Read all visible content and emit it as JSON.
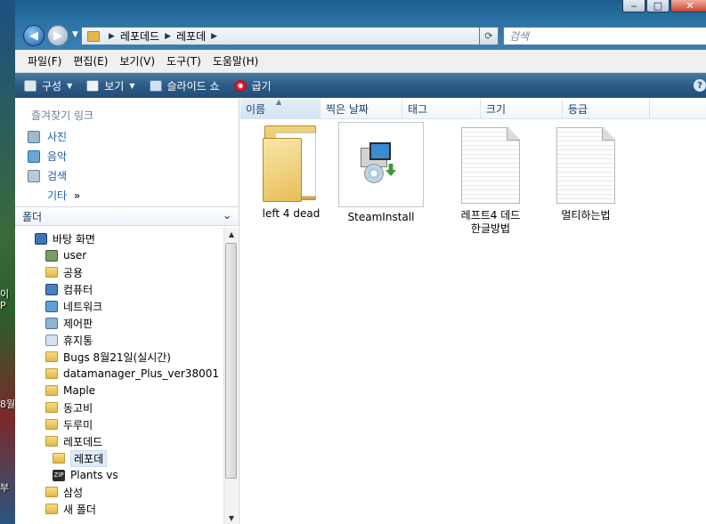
{
  "desktop": {
    "labels": [
      "이",
      "P",
      "8월",
      "부"
    ]
  },
  "window": {
    "caption": {
      "minimize": "‒",
      "maximize": "□",
      "close": "✕"
    },
    "address": {
      "path": [
        "레포데드",
        "레포데"
      ]
    },
    "search": {
      "placeholder": "검색"
    }
  },
  "menubar": {
    "items": [
      "파일(F)",
      "편집(E)",
      "보기(V)",
      "도구(T)",
      "도움말(H)"
    ]
  },
  "toolbar": {
    "organize": "구성",
    "views": "보기",
    "slideshow": "슬라이드 쇼",
    "burn": "굽기"
  },
  "favorites": {
    "title": "즐겨찾기 링크",
    "items": [
      "사진",
      "음악",
      "검색"
    ],
    "more": "기타",
    "more_arrow": "»"
  },
  "folders": {
    "header": "폴더",
    "tree": [
      {
        "label": "바탕 화면",
        "icon": "desktop-icon"
      },
      {
        "label": "user",
        "icon": "user-folder-icon"
      },
      {
        "label": "공용",
        "icon": "folder-icon"
      },
      {
        "label": "컴퓨터",
        "icon": "computer-icon"
      },
      {
        "label": "네트워크",
        "icon": "network-icon"
      },
      {
        "label": "제어판",
        "icon": "control-panel-icon"
      },
      {
        "label": "휴지통",
        "icon": "recycle-bin-icon"
      },
      {
        "label": "Bugs 8월21일(실시간)",
        "icon": "folder-icon"
      },
      {
        "label": "datamanager_Plus_ver38001",
        "icon": "folder-icon"
      },
      {
        "label": "Maple",
        "icon": "folder-icon"
      },
      {
        "label": "동고비",
        "icon": "folder-icon"
      },
      {
        "label": "두루미",
        "icon": "folder-icon"
      },
      {
        "label": "레포데드",
        "icon": "folder-icon"
      },
      {
        "label": "레포데",
        "icon": "folder-icon",
        "selected": true
      },
      {
        "label": "Plants vs",
        "icon": "zip-icon"
      },
      {
        "label": "삼성",
        "icon": "folder-icon"
      },
      {
        "label": "새 폴더",
        "icon": "folder-icon"
      }
    ]
  },
  "columns": [
    "이름",
    "찍은 날짜",
    "태그",
    "크기",
    "등급"
  ],
  "files": [
    {
      "label": "left 4 dead",
      "type": "folder"
    },
    {
      "label": "SteamInstall",
      "type": "installer"
    },
    {
      "label": "레프트4 데드\n한글방법",
      "type": "document"
    },
    {
      "label": "멀티하는법",
      "type": "document"
    }
  ]
}
